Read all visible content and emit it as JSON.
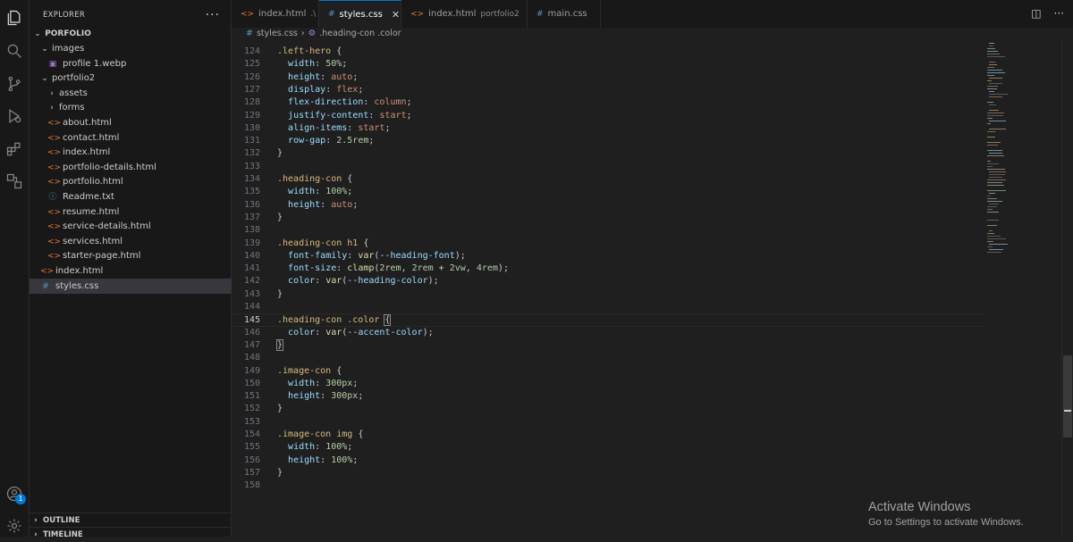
{
  "activity_bar": {
    "icons": [
      "explorer-icon",
      "search-icon",
      "source-control-icon",
      "run-debug-icon",
      "extensions-icon",
      "remote-explorer-icon",
      "account-icon",
      "settings-gear-icon"
    ],
    "account_badge": "1"
  },
  "sidebar": {
    "title": "EXPLORER",
    "more_label": "···",
    "root": "PORFOLIO",
    "tree": [
      {
        "label": "images",
        "type": "folder",
        "expanded": true,
        "depth": 1
      },
      {
        "label": "profile 1.webp",
        "type": "image",
        "depth": 2
      },
      {
        "label": "portfolio2",
        "type": "folder",
        "expanded": true,
        "depth": 1
      },
      {
        "label": "assets",
        "type": "folder",
        "expanded": false,
        "depth": 2
      },
      {
        "label": "forms",
        "type": "folder",
        "expanded": false,
        "depth": 2
      },
      {
        "label": "about.html",
        "type": "html",
        "depth": 2
      },
      {
        "label": "contact.html",
        "type": "html",
        "depth": 2
      },
      {
        "label": "index.html",
        "type": "html",
        "depth": 2
      },
      {
        "label": "portfolio-details.html",
        "type": "html",
        "depth": 2
      },
      {
        "label": "portfolio.html",
        "type": "html",
        "depth": 2
      },
      {
        "label": "Readme.txt",
        "type": "info",
        "depth": 2
      },
      {
        "label": "resume.html",
        "type": "html",
        "depth": 2
      },
      {
        "label": "service-details.html",
        "type": "html",
        "depth": 2
      },
      {
        "label": "services.html",
        "type": "html",
        "depth": 2
      },
      {
        "label": "starter-page.html",
        "type": "html",
        "depth": 2
      },
      {
        "label": "index.html",
        "type": "html",
        "depth": 1
      },
      {
        "label": "styles.css",
        "type": "css",
        "depth": 1,
        "selected": true
      }
    ],
    "outline_label": "OUTLINE",
    "timeline_label": "TIMELINE"
  },
  "tabs": [
    {
      "label": "index.html",
      "sub": ".\\",
      "type": "html",
      "active": false
    },
    {
      "label": "styles.css",
      "sub": "",
      "type": "css",
      "active": true,
      "close": "✕"
    },
    {
      "label": "index.html",
      "sub": "portfolio2",
      "type": "html",
      "active": false
    },
    {
      "label": "main.css",
      "sub": "",
      "type": "css",
      "active": false
    }
  ],
  "breadcrumb": {
    "file": "styles.css",
    "symbol": ".heading-con .color"
  },
  "editor": {
    "current_line": 145,
    "lines": [
      {
        "n": 124,
        "tokens": [
          [
            "sel",
            ".left-hero"
          ],
          [
            "pun",
            " {"
          ]
        ]
      },
      {
        "n": 125,
        "tokens": [
          [
            "pun",
            "  "
          ],
          [
            "prop",
            "width"
          ],
          [
            "pun",
            ": "
          ],
          [
            "num",
            "50%"
          ],
          [
            "pun",
            ";"
          ]
        ]
      },
      {
        "n": 126,
        "tokens": [
          [
            "pun",
            "  "
          ],
          [
            "prop",
            "height"
          ],
          [
            "pun",
            ": "
          ],
          [
            "val",
            "auto"
          ],
          [
            "pun",
            ";"
          ]
        ]
      },
      {
        "n": 127,
        "tokens": [
          [
            "pun",
            "  "
          ],
          [
            "prop",
            "display"
          ],
          [
            "pun",
            ": "
          ],
          [
            "val",
            "flex"
          ],
          [
            "pun",
            ";"
          ]
        ]
      },
      {
        "n": 128,
        "tokens": [
          [
            "pun",
            "  "
          ],
          [
            "prop",
            "flex-direction"
          ],
          [
            "pun",
            ": "
          ],
          [
            "val",
            "column"
          ],
          [
            "pun",
            ";"
          ]
        ]
      },
      {
        "n": 129,
        "tokens": [
          [
            "pun",
            "  "
          ],
          [
            "prop",
            "justify-content"
          ],
          [
            "pun",
            ": "
          ],
          [
            "val",
            "start"
          ],
          [
            "pun",
            ";"
          ]
        ]
      },
      {
        "n": 130,
        "tokens": [
          [
            "pun",
            "  "
          ],
          [
            "prop",
            "align-items"
          ],
          [
            "pun",
            ": "
          ],
          [
            "val",
            "start"
          ],
          [
            "pun",
            ";"
          ]
        ]
      },
      {
        "n": 131,
        "tokens": [
          [
            "pun",
            "  "
          ],
          [
            "prop",
            "row-gap"
          ],
          [
            "pun",
            ": "
          ],
          [
            "num",
            "2.5rem"
          ],
          [
            "pun",
            ";"
          ]
        ]
      },
      {
        "n": 132,
        "tokens": [
          [
            "pun",
            "}"
          ]
        ]
      },
      {
        "n": 133,
        "tokens": []
      },
      {
        "n": 134,
        "tokens": [
          [
            "sel",
            ".heading-con"
          ],
          [
            "pun",
            " {"
          ]
        ]
      },
      {
        "n": 135,
        "tokens": [
          [
            "pun",
            "  "
          ],
          [
            "prop",
            "width"
          ],
          [
            "pun",
            ": "
          ],
          [
            "num",
            "100%"
          ],
          [
            "pun",
            ";"
          ]
        ]
      },
      {
        "n": 136,
        "tokens": [
          [
            "pun",
            "  "
          ],
          [
            "prop",
            "height"
          ],
          [
            "pun",
            ": "
          ],
          [
            "val",
            "auto"
          ],
          [
            "pun",
            ";"
          ]
        ]
      },
      {
        "n": 137,
        "tokens": [
          [
            "pun",
            "}"
          ]
        ]
      },
      {
        "n": 138,
        "tokens": []
      },
      {
        "n": 139,
        "tokens": [
          [
            "sel",
            ".heading-con h1"
          ],
          [
            "pun",
            " {"
          ]
        ]
      },
      {
        "n": 140,
        "tokens": [
          [
            "pun",
            "  "
          ],
          [
            "prop",
            "font-family"
          ],
          [
            "pun",
            ": "
          ],
          [
            "fn",
            "var"
          ],
          [
            "pun",
            "("
          ],
          [
            "prop",
            "--heading-font"
          ],
          [
            "pun",
            ");"
          ]
        ]
      },
      {
        "n": 141,
        "tokens": [
          [
            "pun",
            "  "
          ],
          [
            "prop",
            "font-size"
          ],
          [
            "pun",
            ": "
          ],
          [
            "fn",
            "clamp"
          ],
          [
            "pun",
            "("
          ],
          [
            "num",
            "2rem"
          ],
          [
            "pun",
            ", "
          ],
          [
            "num",
            "2rem"
          ],
          [
            "pun",
            " + "
          ],
          [
            "num",
            "2vw"
          ],
          [
            "pun",
            ", "
          ],
          [
            "num",
            "4rem"
          ],
          [
            "pun",
            ");"
          ]
        ]
      },
      {
        "n": 142,
        "tokens": [
          [
            "pun",
            "  "
          ],
          [
            "prop",
            "color"
          ],
          [
            "pun",
            ": "
          ],
          [
            "fn",
            "var"
          ],
          [
            "pun",
            "("
          ],
          [
            "prop",
            "--heading-color"
          ],
          [
            "pun",
            ");"
          ]
        ]
      },
      {
        "n": 143,
        "tokens": [
          [
            "pun",
            "}"
          ]
        ]
      },
      {
        "n": 144,
        "tokens": []
      },
      {
        "n": 145,
        "tokens": [
          [
            "sel",
            ".heading-con .color"
          ],
          [
            "pun",
            " "
          ],
          [
            "bracket",
            "{"
          ]
        ]
      },
      {
        "n": 146,
        "tokens": [
          [
            "pun",
            "  "
          ],
          [
            "prop",
            "color"
          ],
          [
            "pun",
            ": "
          ],
          [
            "fn",
            "var"
          ],
          [
            "pun",
            "("
          ],
          [
            "prop",
            "--accent-color"
          ],
          [
            "pun",
            ");"
          ]
        ]
      },
      {
        "n": 147,
        "tokens": [
          [
            "bracket",
            "}"
          ]
        ]
      },
      {
        "n": 148,
        "tokens": []
      },
      {
        "n": 149,
        "tokens": [
          [
            "sel",
            ".image-con"
          ],
          [
            "pun",
            " {"
          ]
        ]
      },
      {
        "n": 150,
        "tokens": [
          [
            "pun",
            "  "
          ],
          [
            "prop",
            "width"
          ],
          [
            "pun",
            ": "
          ],
          [
            "num",
            "300px"
          ],
          [
            "pun",
            ";"
          ]
        ]
      },
      {
        "n": 151,
        "tokens": [
          [
            "pun",
            "  "
          ],
          [
            "prop",
            "height"
          ],
          [
            "pun",
            ": "
          ],
          [
            "num",
            "300px"
          ],
          [
            "pun",
            ";"
          ]
        ]
      },
      {
        "n": 152,
        "tokens": [
          [
            "pun",
            "}"
          ]
        ]
      },
      {
        "n": 153,
        "tokens": []
      },
      {
        "n": 154,
        "tokens": [
          [
            "sel",
            ".image-con img"
          ],
          [
            "pun",
            " {"
          ]
        ]
      },
      {
        "n": 155,
        "tokens": [
          [
            "pun",
            "  "
          ],
          [
            "prop",
            "width"
          ],
          [
            "pun",
            ": "
          ],
          [
            "num",
            "100%"
          ],
          [
            "pun",
            ";"
          ]
        ]
      },
      {
        "n": 156,
        "tokens": [
          [
            "pun",
            "  "
          ],
          [
            "prop",
            "height"
          ],
          [
            "pun",
            ": "
          ],
          [
            "num",
            "100%"
          ],
          [
            "pun",
            ";"
          ]
        ]
      },
      {
        "n": 157,
        "tokens": [
          [
            "pun",
            "}"
          ]
        ]
      },
      {
        "n": 158,
        "tokens": []
      }
    ]
  },
  "watermark": {
    "title": "Activate Windows",
    "subtitle": "Go to Settings to activate Windows."
  },
  "colors": {
    "accent": "#0078d4",
    "selector": "#d7ba7d",
    "property": "#9cdcfe",
    "string_value": "#ce9178",
    "number": "#b5cea8",
    "function": "#dcdcaa"
  }
}
